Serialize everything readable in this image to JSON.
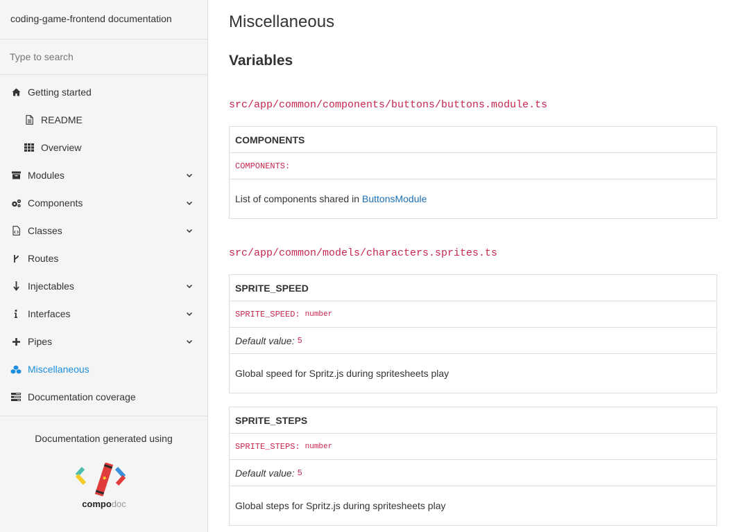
{
  "sidebar": {
    "title": "coding-game-frontend documentation",
    "search_placeholder": "Type to search",
    "items": [
      {
        "label": "Getting started",
        "icon": "home-icon"
      },
      {
        "label": "README",
        "icon": "file-icon"
      },
      {
        "label": "Overview",
        "icon": "grid-icon"
      },
      {
        "label": "Modules",
        "icon": "archive-icon"
      },
      {
        "label": "Components",
        "icon": "cogs-icon"
      },
      {
        "label": "Classes",
        "icon": "file-code-icon"
      },
      {
        "label": "Routes",
        "icon": "code-fork-icon"
      },
      {
        "label": "Injectables",
        "icon": "arrow-down-icon"
      },
      {
        "label": "Interfaces",
        "icon": "info-icon"
      },
      {
        "label": "Pipes",
        "icon": "plus-icon"
      },
      {
        "label": "Miscellaneous",
        "icon": "cubes-icon"
      },
      {
        "label": "Documentation coverage",
        "icon": "tasks-icon"
      }
    ],
    "generated_using": "Documentation generated using",
    "logo_text_bold": "compo",
    "logo_text_light": "doc"
  },
  "main": {
    "page_title": "Miscellaneous",
    "section_title": "Variables",
    "files": [
      {
        "path": "src/app/common/components/buttons/buttons.module.ts",
        "variables": [
          {
            "name": "COMPONENTS",
            "signature": "COMPONENTS:",
            "description": "List of components shared in",
            "link": "ButtonsModule"
          }
        ]
      },
      {
        "path": "src/app/common/models/characters.sprites.ts",
        "variables": [
          {
            "name": "SPRITE_SPEED",
            "signature": "SPRITE_SPEED:",
            "type": "number",
            "default_label": "Default value:",
            "default_value": "5",
            "description": "Global speed for Spritz.js during spritesheets play"
          },
          {
            "name": "SPRITE_STEPS",
            "signature": "SPRITE_STEPS:",
            "type": "number",
            "default_label": "Default value:",
            "default_value": "5",
            "description": "Global steps for Spritz.js during spritesheets play"
          }
        ]
      }
    ]
  },
  "colors": {
    "accent": "#1b8fdd",
    "code": "#c7254e",
    "link": "#1b6fb4",
    "sidebar_bg": "#f5f5f5"
  }
}
